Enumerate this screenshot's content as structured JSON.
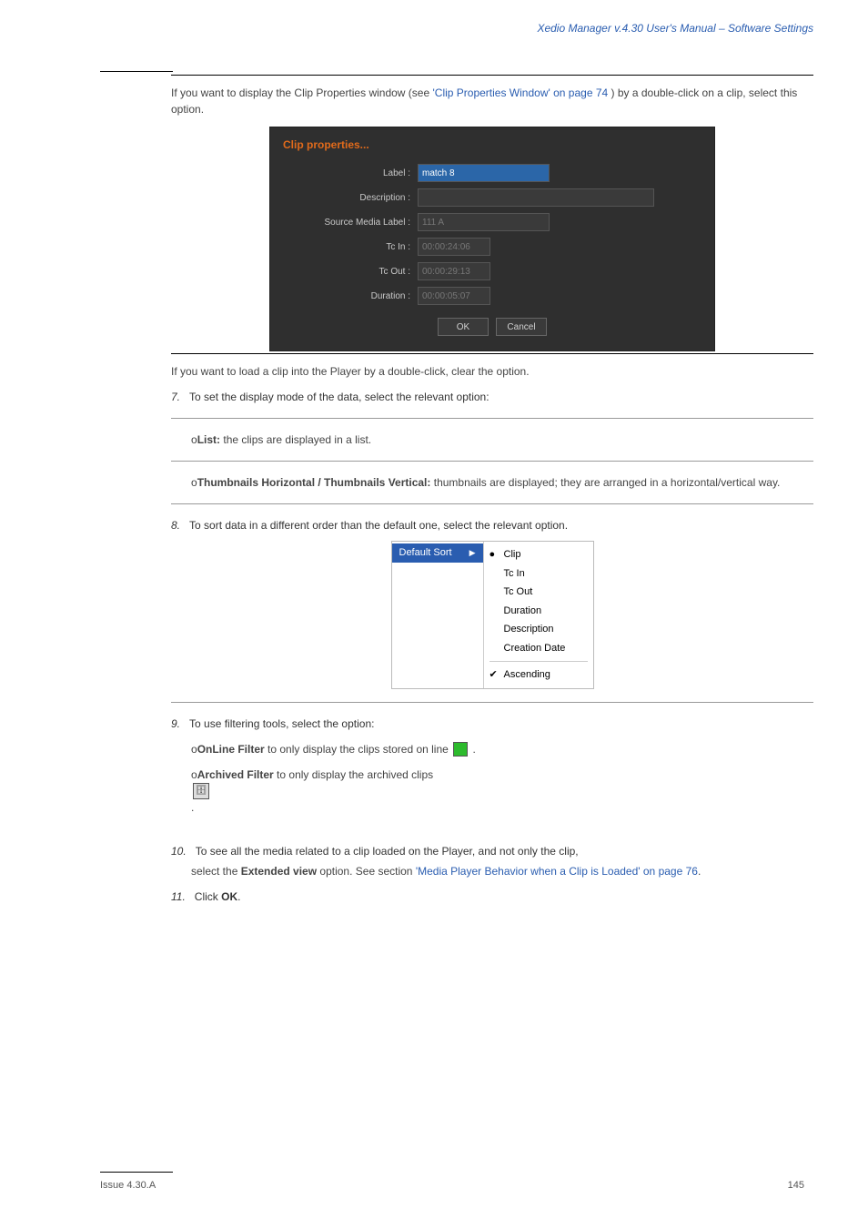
{
  "header_link": "Xedio Manager v.4.30 User's Manual – Software Settings",
  "intro_before_link": "If you want to display the Clip Properties window (see ",
  "intro_link_text": "'Clip Properties Window' on page 74",
  "intro_after_link": ") by a double-click on a clip, select this option.",
  "dialog": {
    "title": "Clip properties...",
    "label_lbl": "Label :",
    "label_val": "match 8",
    "desc_lbl": "Description :",
    "desc_val": "",
    "src_lbl": "Source Media Label :",
    "src_val": "111 A",
    "tcin_lbl": "Tc In :",
    "tcin_val": "00:00:24:06",
    "tcout_lbl": "Tc Out :",
    "tcout_val": "00:00:29:13",
    "dur_lbl": "Duration :",
    "dur_val": "00:00:05:07",
    "ok": "OK",
    "cancel": "Cancel"
  },
  "lines": {
    "l1": "If you want to load a clip into the Player by a double-click, clear the option.",
    "i7": "7.",
    "t7": "To set the display mode of the data, select the relevant option:",
    "o7a_i": "o",
    "o7a_b": "List: ",
    "o7a_t": "the clips are displayed in a list.",
    "o7b_i": "o",
    "o7b_b": "Thumbnails Horizontal / Thumbnails Vertical: ",
    "o7b_t": "thumbnails are displayed; they are arranged in a horizontal/vertical way.",
    "i8": "8.",
    "t8": "To sort data in a different order than the default one, select the relevant option.",
    "i9": "9.",
    "t9": "To use filtering tools, select the option:",
    "o9a_i": "o",
    "o9a_b": "OnLine Filter ",
    "o9a_t": "to only display the clips stored on line ",
    "o9a_t2": ".",
    "o9b_i": "o",
    "o9b_b": "Archived Filter ",
    "o9b_t": "to only display the archived clips ",
    "o9b_t2": ".",
    "i10": "10.",
    "t10a": "To see all the media related to a clip loaded on the Player, and not only the clip,",
    "t10b_pre": "select the ",
    "t10b_b": "Extended view",
    "t10b_post": " option. See section ",
    "t10b_link": "'Media Player Behavior when a Clip is Loaded' on page 76",
    "t10b_post2": ".",
    "i11": "11.",
    "t11_pre": "Click ",
    "t11_b": "OK",
    "t11_post": "."
  },
  "menu": {
    "left": "Default Sort",
    "items": [
      "Clip",
      "Tc In",
      "Tc Out",
      "Duration",
      "Description",
      "Creation Date"
    ],
    "asc": "Ascending"
  },
  "footer": {
    "left": "Issue 4.30.A",
    "right": "145"
  }
}
